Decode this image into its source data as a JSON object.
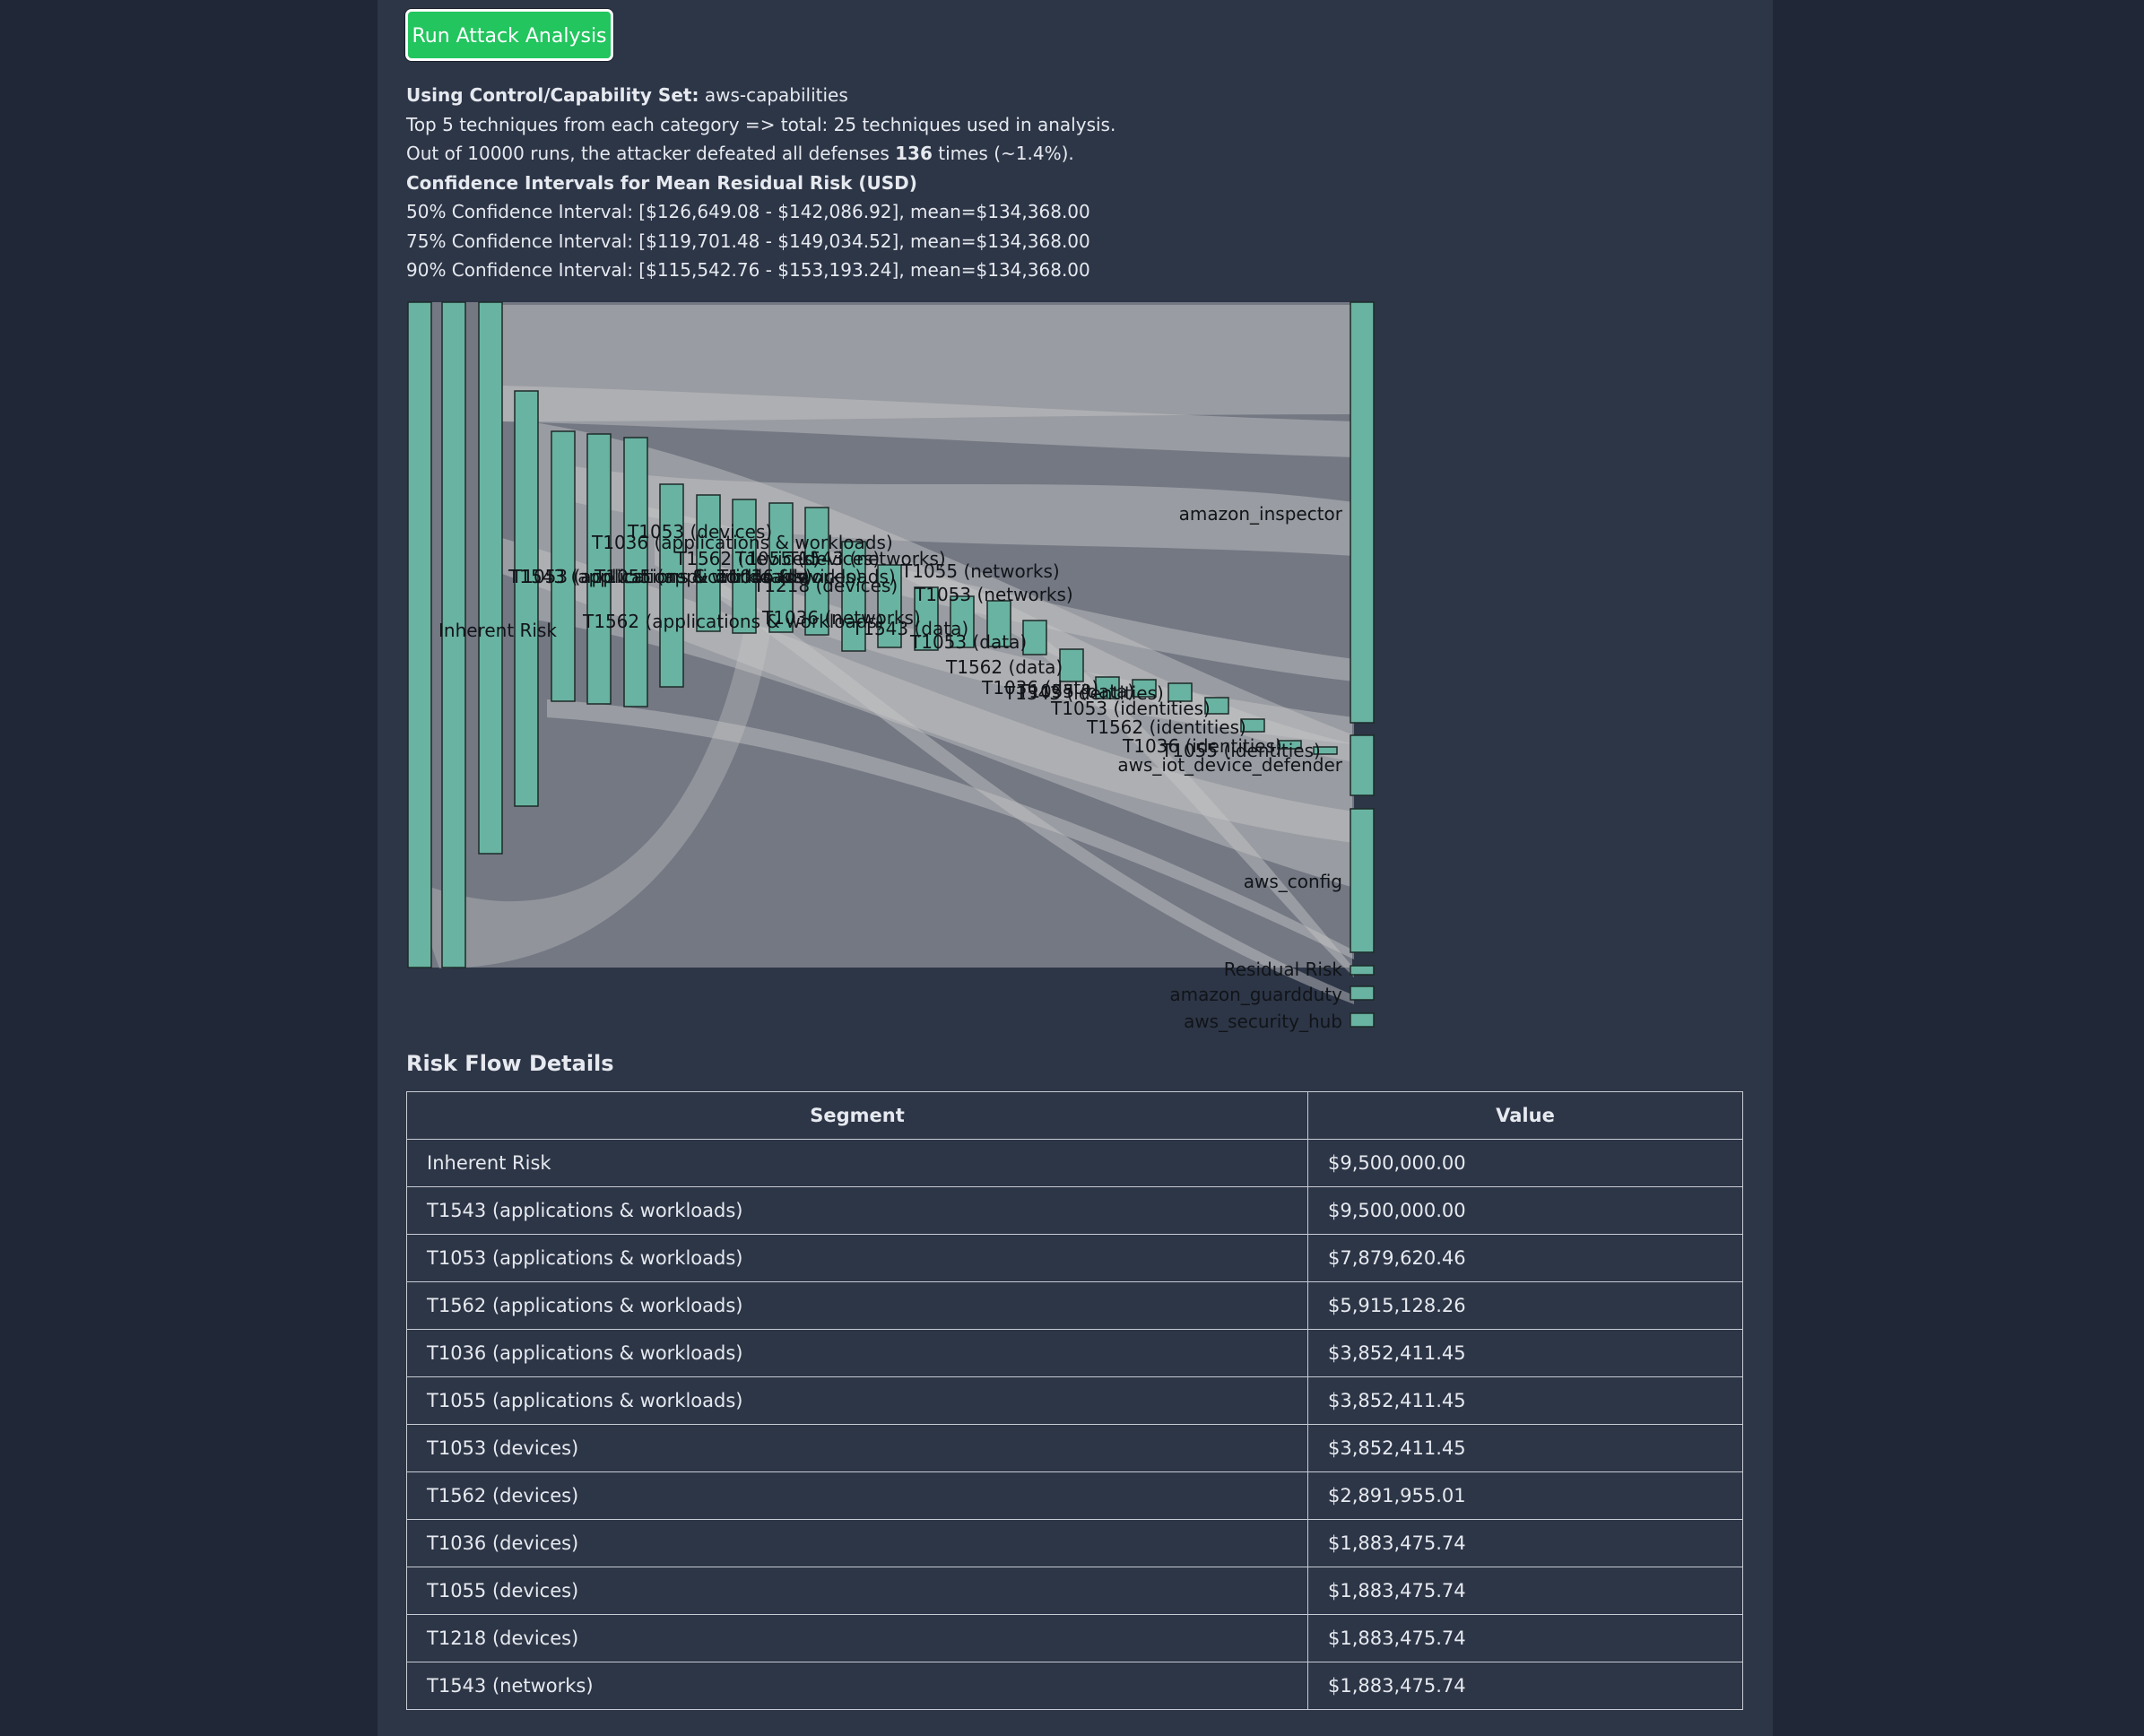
{
  "run_button_label": "Run Attack Analysis",
  "info": {
    "control_set_label": "Using Control/Capability Set:",
    "control_set_value": "aws-capabilities",
    "techniques_line": "Top 5 techniques from each category => total: 25 techniques used in analysis.",
    "runs_prefix": "Out of 10000 runs, the attacker defeated all defenses",
    "runs_count": "136",
    "runs_suffix": "times (~1.4%).",
    "ci_heading": "Confidence Intervals for Mean Residual Risk (USD)",
    "ci_lines": [
      "50% Confidence Interval: [$126,649.08 - $142,086.92], mean=$134,368.00",
      "75% Confidence Interval: [$119,701.48 - $149,034.52], mean=$134,368.00",
      "90% Confidence Interval: [$115,542.76 - $153,193.24], mean=$134,368.00"
    ]
  },
  "chart_data": {
    "type": "sankey",
    "node_labels": [
      "Inherent Risk",
      "T1543 (applications & workloads)",
      "T1053 (applications & workloads)",
      "T1562 (applications & workloads)",
      "T1036 (applications & workloads)",
      "T1055 (applications & workloads)",
      "T1053 (devices)",
      "T1562 (devices)",
      "T1036 (devices)",
      "T1055 (devices)",
      "T1218 (devices)",
      "T1543 (networks)",
      "T1036 (networks)",
      "T1055 (networks)",
      "T1053 (networks)",
      "T1543 (data)",
      "T1053 (data)",
      "T1562 (data)",
      "T1036 (data)",
      "T1055 (data)",
      "T1543 (identities)",
      "T1053 (identities)",
      "T1562 (identities)",
      "T1036 (identities)",
      "T1055 (identities)",
      "amazon_inspector",
      "aws_iot_device_defender",
      "aws_config",
      "Residual Risk",
      "amazon_guardduty",
      "aws_security_hub"
    ],
    "colors": {
      "node": "#69b3a2",
      "link": "#c8c8c8"
    }
  },
  "details": {
    "title": "Risk Flow Details",
    "headers": [
      "Segment",
      "Value"
    ],
    "rows": [
      [
        "Inherent Risk",
        "$9,500,000.00"
      ],
      [
        "T1543 (applications & workloads)",
        "$9,500,000.00"
      ],
      [
        "T1053 (applications & workloads)",
        "$7,879,620.46"
      ],
      [
        "T1562 (applications & workloads)",
        "$5,915,128.26"
      ],
      [
        "T1036 (applications & workloads)",
        "$3,852,411.45"
      ],
      [
        "T1055 (applications & workloads)",
        "$3,852,411.45"
      ],
      [
        "T1053 (devices)",
        "$3,852,411.45"
      ],
      [
        "T1562 (devices)",
        "$2,891,955.01"
      ],
      [
        "T1036 (devices)",
        "$1,883,475.74"
      ],
      [
        "T1055 (devices)",
        "$1,883,475.74"
      ],
      [
        "T1218 (devices)",
        "$1,883,475.74"
      ],
      [
        "T1543 (networks)",
        "$1,883,475.74"
      ]
    ]
  }
}
